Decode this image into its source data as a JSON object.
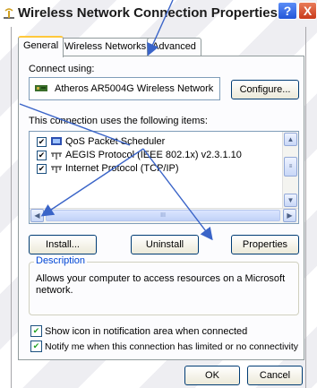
{
  "window": {
    "title": "Wireless Network Connection Properties",
    "help_glyph": "?",
    "close_glyph": "X"
  },
  "tabs": [
    {
      "label": "General",
      "active": true
    },
    {
      "label": "Wireless Networks",
      "active": false
    },
    {
      "label": "Advanced",
      "active": false
    }
  ],
  "connect_using": {
    "label": "Connect using:",
    "adapter": "Atheros AR5004G Wireless Network",
    "configure_label": "Configure..."
  },
  "items": {
    "label": "This connection uses the following items:",
    "list": [
      {
        "name": "QoS Packet Scheduler",
        "checked": true
      },
      {
        "name": "AEGIS Protocol (IEEE 802.1x) v2.3.1.10",
        "checked": true
      },
      {
        "name": "Internet Protocol (TCP/IP)",
        "checked": true
      }
    ],
    "scroll_glyph": "III"
  },
  "buttons": {
    "install": "Install...",
    "uninstall": "Uninstall",
    "properties": "Properties",
    "ok": "OK",
    "cancel": "Cancel"
  },
  "description": {
    "legend": "Description",
    "text_line1": "Allows your computer to access resources on a Microsoft",
    "text_line2": "network."
  },
  "options": {
    "show_icon": {
      "label": "Show icon in notification area when connected",
      "checked": true
    },
    "notify": {
      "label": "Notify me when this connection has limited or no connectivity",
      "checked": true
    }
  },
  "colors": {
    "arrow": "#3a64c8",
    "legend": "#0046d5",
    "check": "#21a121"
  }
}
